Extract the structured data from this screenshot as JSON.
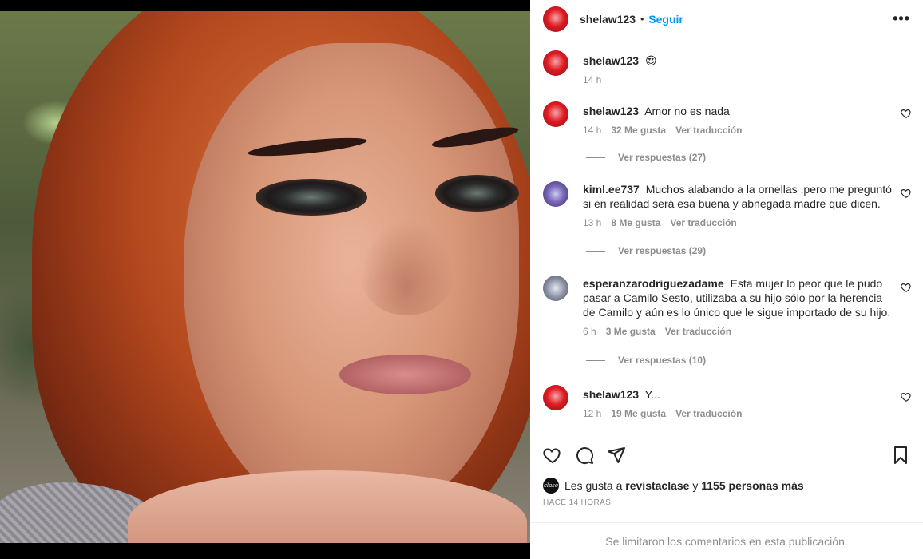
{
  "post": {
    "author": "shelaw123",
    "follow_label": "Seguir",
    "separator": "•",
    "more_label": "•••"
  },
  "caption": {
    "user": "shelaw123",
    "text": "😍",
    "time": "14 h"
  },
  "comments": [
    {
      "user": "shelaw123",
      "text": "Amor no es nada",
      "time": "14 h",
      "likes": "32 Me gusta",
      "translate": "Ver traducción",
      "replies": "Ver respuestas (27)"
    },
    {
      "user": "kiml.ee737",
      "text": "Muchos alabando a la ornellas ,pero me preguntó si en realidad será esa buena y abnegada madre que dicen.",
      "time": "13 h",
      "likes": "8 Me gusta",
      "translate": "Ver traducción",
      "replies": "Ver respuestas (29)"
    },
    {
      "user": "esperanzarodriguezadame",
      "text": "Esta mujer lo peor que le pudo pasar a Camilo Sesto, utilizaba a su hijo sólo por la herencia de Camilo y aún es lo único que le sigue importado de su hijo.",
      "time": "6 h",
      "likes": "3 Me gusta",
      "translate": "Ver traducción",
      "replies": "Ver respuestas (10)"
    },
    {
      "user": "shelaw123",
      "text": "Y...",
      "time": "12 h",
      "likes": "19 Me gusta",
      "translate": "Ver traducción"
    }
  ],
  "likes_summary": {
    "avatar_text": "clase",
    "prefix": "Les gusta a",
    "user": "revistaclase",
    "connector": "y",
    "others": "1155 personas más"
  },
  "time_ago": "HACE 14 HORAS",
  "footer_note": "Se limitaron los comentarios en esta publicación.",
  "icons": [
    "heart-icon",
    "comment-icon",
    "share-icon",
    "bookmark-icon",
    "more-icon"
  ]
}
